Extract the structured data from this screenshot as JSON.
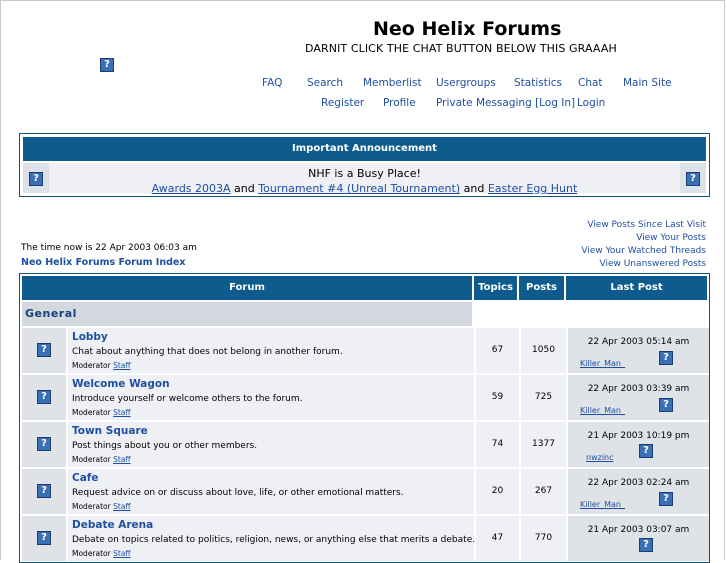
{
  "header": {
    "title": "Neo Helix Forums",
    "description": "DARNIT CLICK THE CHAT BUTTON BELOW THIS GRAAAH",
    "nav_row1": [
      "FAQ",
      "Search",
      "Memberlist",
      "Usergroups",
      "Statistics",
      "Chat",
      "Main Site"
    ],
    "nav_row2": [
      "Register",
      "Profile",
      "Private Messaging [Log In]",
      "Login"
    ]
  },
  "announcement": {
    "heading": "Important Announcement",
    "line1": "NHF is a Busy Place!",
    "link1": "Awards 2003A",
    "and1": " and ",
    "link2": "Tournament #4 (Unreal Tournament)",
    "and2": " and ",
    "link3": "Easter Egg Hunt"
  },
  "right_links": [
    "View Posts Since Last Visit",
    "View Your Posts",
    "View Your Watched Threads",
    "View Unanswered Posts"
  ],
  "time_now": "The time now is 22 Apr 2003 06:03 am",
  "forum_index": "Neo Helix Forums Forum Index",
  "table": {
    "headers": {
      "forum": "Forum",
      "topics": "Topics",
      "posts": "Posts",
      "last_post": "Last Post"
    },
    "category": "General",
    "moderator_label": "Moderator",
    "rows": [
      {
        "name": "Lobby",
        "description": "Chat about anything that does not belong in another forum.",
        "moderator": "Staff",
        "topics": "67",
        "posts": "1050",
        "last_date": "22 Apr 2003 05:14 am",
        "last_user": "Killer_Man_"
      },
      {
        "name": "Welcome Wagon",
        "description": "Introduce yourself or welcome others to the forum.",
        "moderator": "Staff",
        "topics": "59",
        "posts": "725",
        "last_date": "22 Apr 2003 03:39 am",
        "last_user": "Killer_Man_"
      },
      {
        "name": "Town Square",
        "description": "Post things about you or other members.",
        "moderator": "Staff",
        "topics": "74",
        "posts": "1377",
        "last_date": "21 Apr 2003 10:19 pm",
        "last_user": "nwzinc"
      },
      {
        "name": "Cafe",
        "description": "Request advice on or discuss about love, life, or other emotional matters.",
        "moderator": "Staff",
        "topics": "20",
        "posts": "267",
        "last_date": "22 Apr 2003 02:24 am",
        "last_user": "Killer_Man_"
      },
      {
        "name": "Debate Arena",
        "description": "Debate on topics related to politics, religion, news, or anything else that merits a debate.",
        "moderator": "Staff",
        "topics": "47",
        "posts": "770",
        "last_date": "21 Apr 2003 03:07 am",
        "last_user": ""
      }
    ]
  },
  "colors": {
    "header_bar": "#0e5c8e",
    "link": "#1f4fa1",
    "category_bg": "#d3d9df"
  }
}
